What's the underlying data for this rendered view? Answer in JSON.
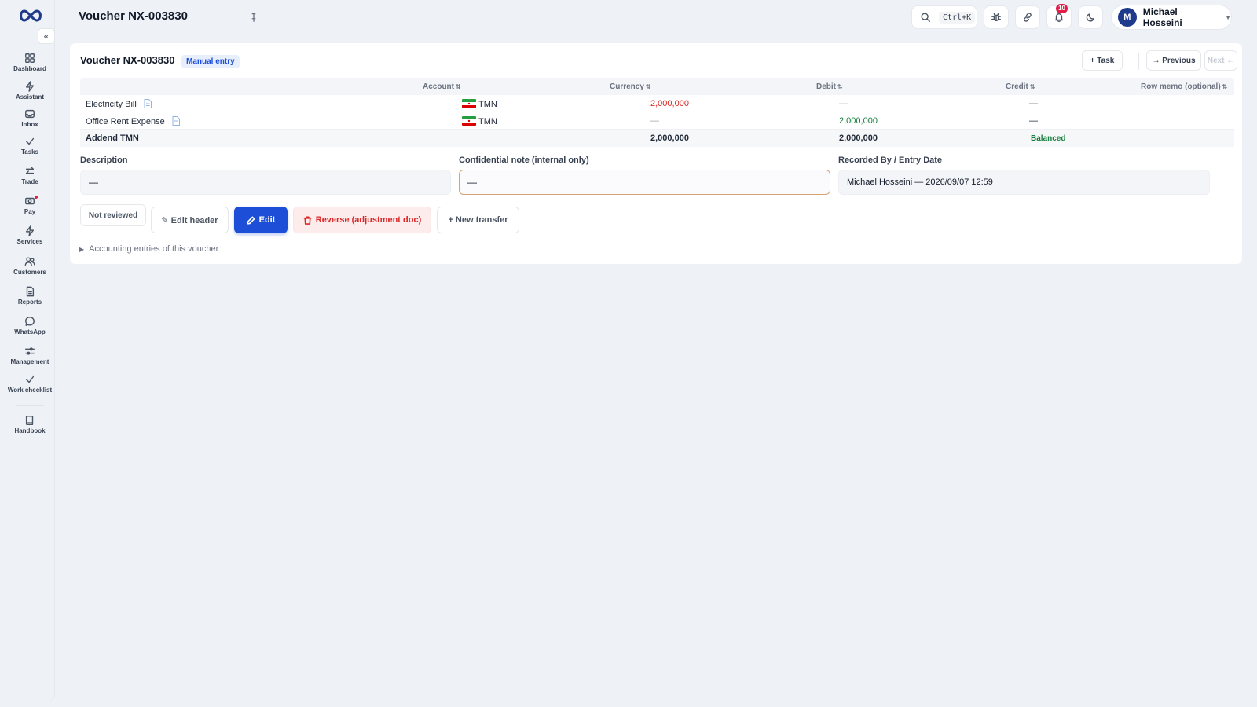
{
  "app": {
    "brand_color": "#1d4ed8"
  },
  "header": {
    "title": "Voucher NX-003830",
    "search_shortcut": "Ctrl+K",
    "notifications_count": "10",
    "user": {
      "initial": "M",
      "name": "Michael Hosseini"
    }
  },
  "sidebar": {
    "items": [
      {
        "label": "Dashboard",
        "icon": "grid-icon"
      },
      {
        "label": "Assistant",
        "icon": "bolt-icon"
      },
      {
        "label": "Inbox",
        "icon": "inbox-icon"
      },
      {
        "label": "Tasks",
        "icon": "check-icon"
      },
      {
        "label": "Trade",
        "icon": "swap-icon"
      },
      {
        "label": "Pay",
        "icon": "cash-icon"
      },
      {
        "label": "Services",
        "icon": "bolt-icon"
      },
      {
        "label": "Customers",
        "icon": "users-icon"
      },
      {
        "label": "Reports",
        "icon": "report-icon"
      },
      {
        "label": "WhatsApp",
        "icon": "chat-icon"
      },
      {
        "label": "Management",
        "icon": "sliders-icon"
      },
      {
        "label": "Work checklist",
        "icon": "check-icon"
      },
      {
        "label": "Handbook",
        "icon": "book-icon"
      }
    ]
  },
  "voucher": {
    "title": "Voucher NX-003830",
    "type_badge": "Manual entry",
    "task_button": "+ Task",
    "previous_button": "→ Previous",
    "next_button": "Next ←",
    "columns": {
      "account": "Account",
      "currency": "Currency",
      "debit": "Debit",
      "credit": "Credit",
      "memo": "Row memo (optional)"
    },
    "rows": [
      {
        "account": "Electricity Bill",
        "currency": "TMN",
        "debit": "2,000,000",
        "credit": "—",
        "memo": "—"
      },
      {
        "account": "Office Rent Expense",
        "currency": "TMN",
        "debit": "—",
        "credit": "2,000,000",
        "memo": "—"
      }
    ],
    "total": {
      "label": "Addend TMN",
      "debit": "2,000,000",
      "credit": "2,000,000",
      "status": "Balanced"
    },
    "fields": {
      "description_label": "Description",
      "description_value": "—",
      "note_label": "Confidential note (internal only)",
      "note_value": "—",
      "recorded_label": "Recorded By / Entry Date",
      "recorded_value": "Michael Hosseini — 2026/09/07 12:59"
    },
    "actions": {
      "review_status": "Not reviewed",
      "edit_header": "✎ Edit header",
      "edit": "Edit",
      "reverse": "Reverse (adjustment doc)",
      "new_transfer": "+ New transfer"
    },
    "entries_expander": "Accounting entries of this voucher"
  }
}
